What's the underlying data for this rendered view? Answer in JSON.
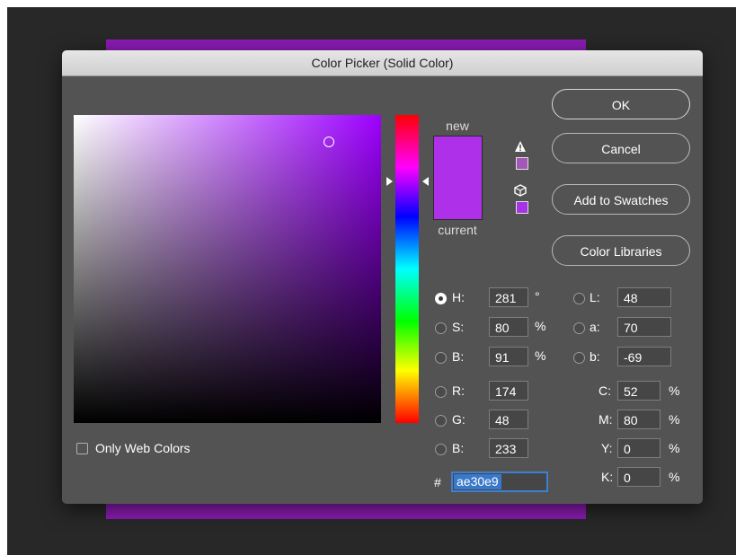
{
  "dialog": {
    "title": "Color Picker (Solid Color)"
  },
  "colors": {
    "document_strip": "#8b1cb3",
    "new_color": "#ae30e9",
    "current_color": "#ae30e9",
    "gamut_chip": "#a457b8",
    "web_chip": "#a633e6",
    "hue_pure": "#9d00ff",
    "selection_blue": "#3a78c9"
  },
  "swatch": {
    "new_label": "new",
    "current_label": "current",
    "gamut_warning_icon": "warning-triangle-icon",
    "web_safe_icon": "cube-icon"
  },
  "buttons": {
    "ok": "OK",
    "cancel": "Cancel",
    "add_to_swatches": "Add to Swatches",
    "color_libraries": "Color Libraries"
  },
  "hsb": [
    {
      "label": "H:",
      "value": "281",
      "unit": "°",
      "selected": true
    },
    {
      "label": "S:",
      "value": "80",
      "unit": "%",
      "selected": false
    },
    {
      "label": "B:",
      "value": "91",
      "unit": "%",
      "selected": false
    }
  ],
  "rgb": [
    {
      "label": "R:",
      "value": "174"
    },
    {
      "label": "G:",
      "value": "48"
    },
    {
      "label": "B:",
      "value": "233"
    }
  ],
  "lab": [
    {
      "label": "L:",
      "value": "48"
    },
    {
      "label": "a:",
      "value": "70"
    },
    {
      "label": "b:",
      "value": "-69"
    }
  ],
  "cmyk": [
    {
      "label": "C:",
      "value": "52",
      "unit": "%"
    },
    {
      "label": "M:",
      "value": "80",
      "unit": "%"
    },
    {
      "label": "Y:",
      "value": "0",
      "unit": "%"
    },
    {
      "label": "K:",
      "value": "0",
      "unit": "%"
    }
  ],
  "hex": {
    "prefix": "#",
    "value": "ae30e9"
  },
  "only_web_colors": {
    "label": "Only Web Colors",
    "checked": false
  }
}
